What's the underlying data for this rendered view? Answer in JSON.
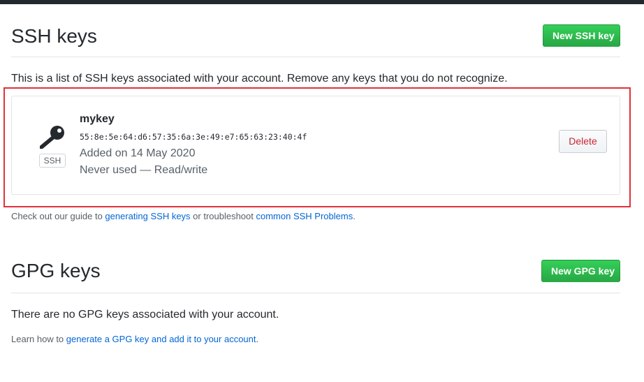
{
  "ssh": {
    "title": "SSH keys",
    "new_button": "New SSH key",
    "description": "This is a list of SSH keys associated with your account. Remove any keys that you do not recognize.",
    "key": {
      "badge": "SSH",
      "name": "mykey",
      "fingerprint": "55:8e:5e:64:d6:57:35:6a:3e:49:e7:65:63:23:40:4f",
      "added": "Added on 14 May 2020",
      "usage": "Never used — Read/write",
      "delete_button": "Delete",
      "icon": "key-icon"
    },
    "guide": {
      "prefix": "Check out our guide to ",
      "link1": "generating SSH keys",
      "middle": " or troubleshoot ",
      "link2": "common SSH Problems",
      "suffix": "."
    }
  },
  "gpg": {
    "title": "GPG keys",
    "new_button": "New GPG key",
    "empty_text": "There are no GPG keys associated with your account.",
    "learn": {
      "prefix": "Learn how to ",
      "link": "generate a GPG key and add it to your account",
      "suffix": "."
    }
  },
  "colors": {
    "primary_green": "#28a745",
    "link_blue": "#0366d6",
    "danger_red": "#cb2431",
    "highlight_red": "#e0313a"
  }
}
